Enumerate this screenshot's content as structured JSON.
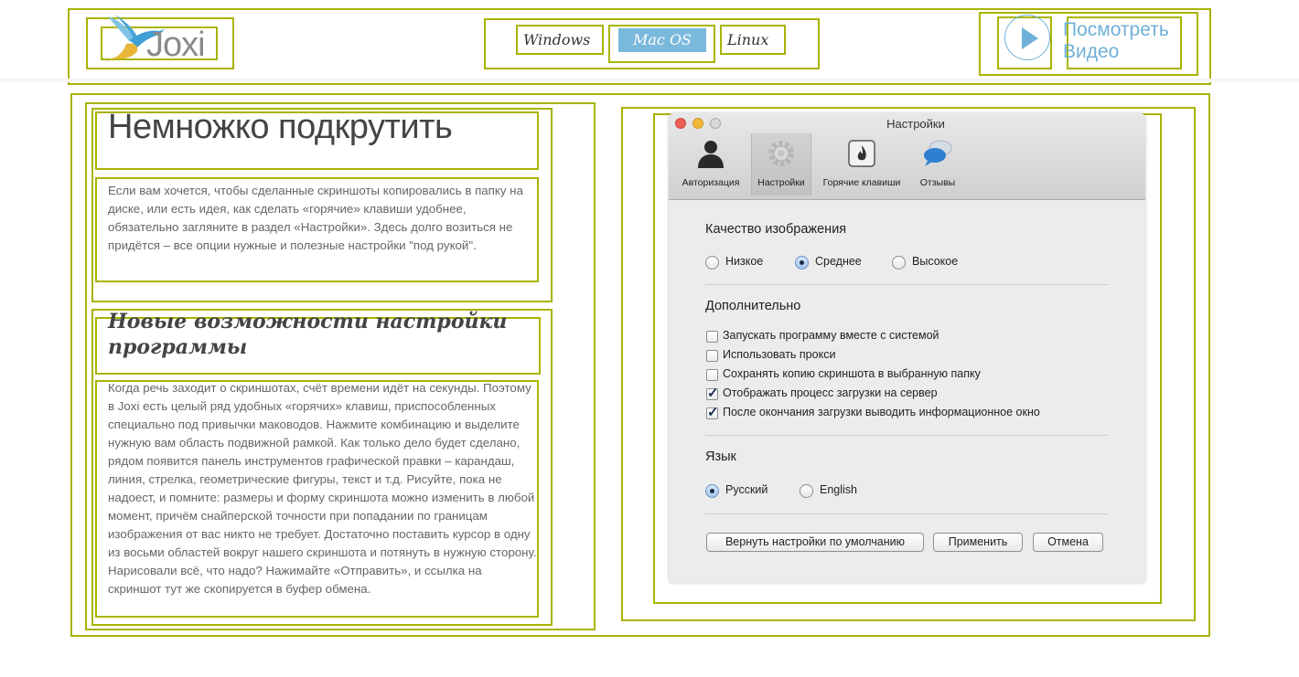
{
  "header": {
    "logo_text": "Joxi",
    "os_tabs": [
      {
        "label": "Windows",
        "active": false
      },
      {
        "label": "Mac OS",
        "active": true
      },
      {
        "label": "Linux",
        "active": false
      }
    ],
    "video_link": {
      "line1": "Посмотреть",
      "line2": "Видео",
      "icon": "play-icon"
    }
  },
  "left": {
    "section1": {
      "title": "Немножко подкрутить",
      "text": "Если вам хочется, чтобы сделанные скриншоты копировались в папку на диске, или есть идея, как сделать «горячие» клавиши удобнее, обязательно загляните в раздел «Настройки». Здесь долго возиться не придётся – все опции нужные и полезные настройки \"под рукой\"."
    },
    "section2": {
      "title": "Новые возможности настройки программы",
      "text": "Когда речь заходит о скриншотах, счёт времени идёт на секунды. Поэтому в Joxi есть целый ряд удобных «горячих» клавиш, приспособленных специально под привычки маководов. Нажмите комбинацию и выделите нужную вам область подвижной рамкой. Как только дело будет сделано, рядом появится панель инструментов графической правки – карандаш, линия, стрелка, геометрические фигуры, текст и т.д. Рисуйте, пока не надоест, и помните: размеры и форму скриншота можно изменить в любой момент, причём снайперской точности при попадании по границам изображения от вас никто не требует. Достаточно поставить курсор в одну из восьми областей вокруг нашего скриншота и потянуть в нужную сторону. Нарисовали всё, что надо? Нажимайте «Отправить», и ссылка на скриншот тут же скопируется в буфер обмена."
    }
  },
  "mac_window": {
    "title": "Настройки",
    "traffic_colors": [
      "#ec5d55",
      "#f3b93b",
      "#c9c9c9"
    ],
    "toolbar": [
      {
        "label": "Авторизация",
        "icon": "user-icon",
        "selected": false
      },
      {
        "label": "Настройки",
        "icon": "gear-icon",
        "selected": true
      },
      {
        "label": "Горячие клавиши",
        "icon": "hotkey-icon",
        "selected": false
      },
      {
        "label": "Отзывы",
        "icon": "chat-bubbles-icon",
        "selected": false
      }
    ],
    "quality": {
      "title": "Качество изображения",
      "options": [
        {
          "label": "Низкое",
          "selected": false
        },
        {
          "label": "Среднее",
          "selected": true
        },
        {
          "label": "Высокое",
          "selected": false
        }
      ]
    },
    "extra": {
      "title": "Дополнительно",
      "checkboxes": [
        {
          "label": "Запускать программу вместе с системой",
          "checked": false
        },
        {
          "label": "Использовать прокси",
          "checked": false
        },
        {
          "label": "Сохранять копию скриншота в выбранную папку",
          "checked": false
        },
        {
          "label": "Отображать процесс загрузки на сервер",
          "checked": true
        },
        {
          "label": "После окончания загрузки выводить информационное окно",
          "checked": true
        }
      ]
    },
    "language": {
      "title": "Язык",
      "options": [
        {
          "label": "Русский",
          "selected": true
        },
        {
          "label": "English",
          "selected": false
        }
      ]
    },
    "buttons": {
      "reset": "Вернуть настройки по умолчанию",
      "apply": "Применить",
      "cancel": "Отмена"
    }
  },
  "colors": {
    "outline": "#a8b400",
    "accent": "#7ab8dc",
    "link": "#6fb0d8"
  }
}
